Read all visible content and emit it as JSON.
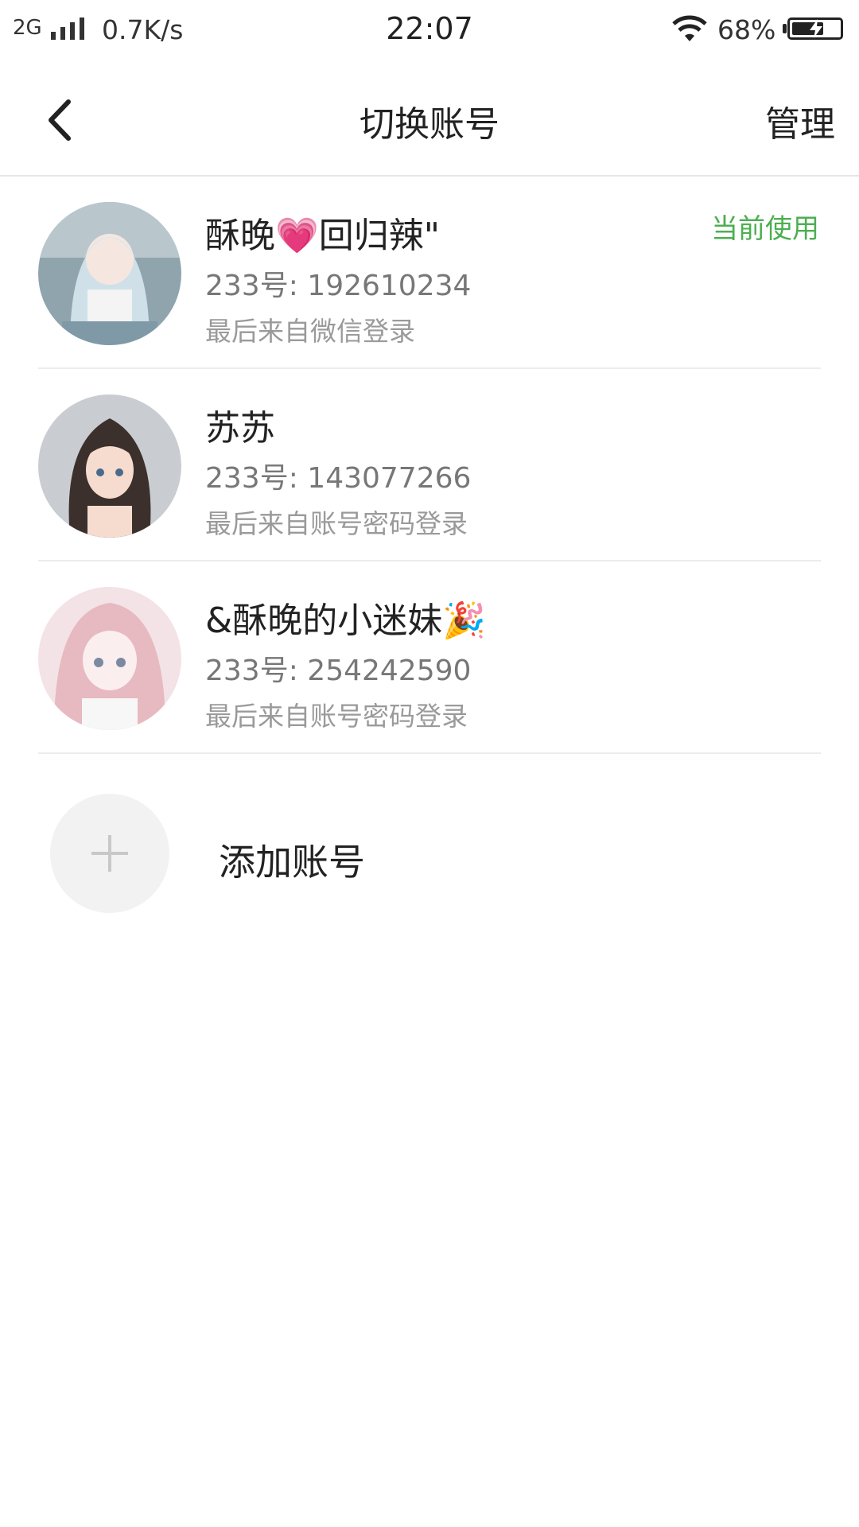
{
  "status_bar": {
    "network": "2G",
    "speed": "0.7K/s",
    "time": "22:07",
    "battery_percent": "68%",
    "battery_level": 0.68,
    "icons": [
      "signal-icon",
      "wifi-icon",
      "battery-icon",
      "charging-icon"
    ]
  },
  "header": {
    "title": "切换账号",
    "manage_label": "管理",
    "back_icon": "chevron-left-icon"
  },
  "accounts": [
    {
      "name": "酥晚💗回归辣\"",
      "id_text": "233号: 192610234",
      "login_text": "最后来自微信登录",
      "current_label": "当前使用"
    },
    {
      "name": "苏苏",
      "id_text": "233号: 143077266",
      "login_text": "最后来自账号密码登录"
    },
    {
      "name": "&酥晚的小迷妹🎉",
      "id_text": "233号: 254242590",
      "login_text": "最后来自账号密码登录"
    }
  ],
  "add_account": {
    "label": "添加账号",
    "icon": "plus-icon"
  },
  "colors": {
    "accent_green": "#4caf50",
    "text_primary": "#222222",
    "text_secondary": "#777777",
    "text_tertiary": "#9a9a9a"
  }
}
